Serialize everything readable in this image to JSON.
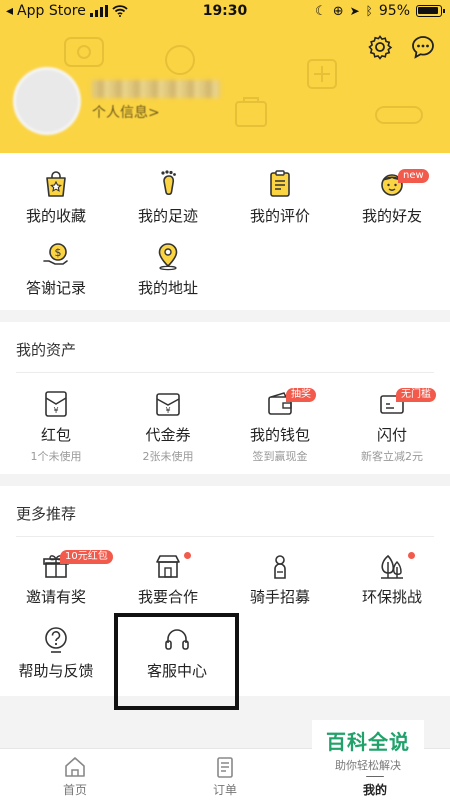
{
  "statusbar": {
    "carrier": "App Store",
    "time": "19:30",
    "battery": "95%"
  },
  "header": {
    "profile_link": "个人信息>"
  },
  "colors": {
    "brand_yellow": "#fbd444",
    "badge_red": "#f25a4b"
  },
  "top_menu": [
    {
      "label": "我的收藏",
      "icon": "star-bag-icon"
    },
    {
      "label": "我的足迹",
      "icon": "footprint-icon"
    },
    {
      "label": "我的评价",
      "icon": "review-icon"
    },
    {
      "label": "我的好友",
      "icon": "friend-face-icon",
      "badge": "new"
    },
    {
      "label": "答谢记录",
      "icon": "thanks-coin-icon"
    },
    {
      "label": "我的地址",
      "icon": "location-pin-icon"
    }
  ],
  "assets": {
    "title": "我的资产",
    "items": [
      {
        "label": "红包",
        "sub": "1个未使用",
        "icon": "red-envelope-icon"
      },
      {
        "label": "代金券",
        "sub": "2张未使用",
        "icon": "voucher-icon"
      },
      {
        "label": "我的钱包",
        "sub": "签到赢现金",
        "icon": "wallet-icon",
        "badge": "抽奖"
      },
      {
        "label": "闪付",
        "sub": "新客立减2元",
        "icon": "quick-pay-icon",
        "badge": "无门槛"
      }
    ]
  },
  "recommend": {
    "title": "更多推荐",
    "items": [
      {
        "label": "邀请有奖",
        "icon": "gift-icon",
        "badge": "10元红包"
      },
      {
        "label": "我要合作",
        "icon": "shop-icon",
        "dot": true
      },
      {
        "label": "骑手招募",
        "icon": "scooter-icon"
      },
      {
        "label": "环保挑战",
        "icon": "trees-icon",
        "dot": true
      },
      {
        "label": "帮助与反馈",
        "icon": "help-icon"
      },
      {
        "label": "客服中心",
        "icon": "headset-icon"
      }
    ]
  },
  "tabs": [
    {
      "label": "首页",
      "icon": "home-icon"
    },
    {
      "label": "订单",
      "icon": "order-icon"
    },
    {
      "label": "我的",
      "icon": "mine-icon",
      "active": true
    }
  ],
  "watermark": {
    "title": "百科全说",
    "subtitle": "助你轻松解决"
  }
}
